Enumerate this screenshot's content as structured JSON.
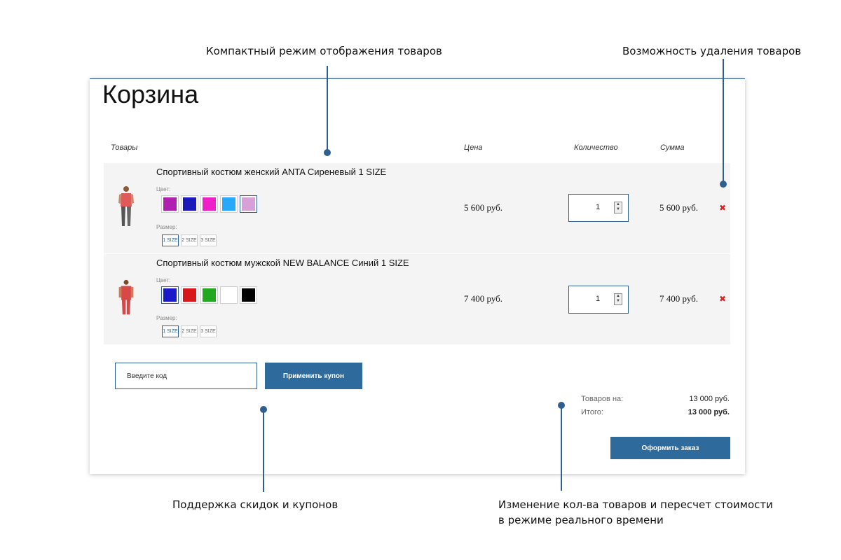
{
  "annotations": {
    "compact_mode": "Компактный режим отображения товаров",
    "removal": "Возможность удаления товаров",
    "coupons": "Поддержка скидок и купонов",
    "realtime_line1": "Изменение кол-ва товаров и пересчет стоимости",
    "realtime_line2": "в режиме реального времени"
  },
  "cart": {
    "title": "Корзина",
    "columns": {
      "products": "Товары",
      "price": "Цена",
      "quantity": "Количество",
      "sum": "Сумма"
    },
    "items": [
      {
        "name": "Спортивный костюм женский ANTA Сиреневый 1 SIZE",
        "color_label": "Цвет:",
        "colors": [
          "#b020b0",
          "#1a1ab8",
          "#f020c8",
          "#28a8f8",
          "#d8a0d8"
        ],
        "selected_color_index": 4,
        "size_label": "Размер:",
        "sizes": [
          "1 SIZE",
          "2 SIZE",
          "3 SIZE"
        ],
        "selected_size_index": 0,
        "price": "5 600 руб.",
        "quantity": "1",
        "sum": "5 600 руб.",
        "remove": "✖"
      },
      {
        "name": "Спортивный костюм мужской NEW BALANCE Синий 1 SIZE",
        "color_label": "Цвет:",
        "colors": [
          "#1a1ac8",
          "#d81818",
          "#20a820",
          "#ffffff",
          "#000000"
        ],
        "selected_color_index": 0,
        "size_label": "Размер:",
        "sizes": [
          "1 SIZE",
          "2 SIZE",
          "3 SIZE"
        ],
        "selected_size_index": 0,
        "price": "7 400 руб.",
        "quantity": "1",
        "sum": "7 400 руб.",
        "remove": "✖"
      }
    ],
    "coupon": {
      "placeholder": "Введите код",
      "apply_label": "Применить купон"
    },
    "totals": {
      "subtotal_label": "Товаров на:",
      "subtotal_value": "13 000 руб.",
      "total_label": "Итого:",
      "total_value": "13 000 руб."
    },
    "checkout_label": "Оформить заказ"
  },
  "colors": {
    "accent": "#2f6a9c",
    "remove": "#d62828",
    "row_bg": "#f4f4f4"
  }
}
